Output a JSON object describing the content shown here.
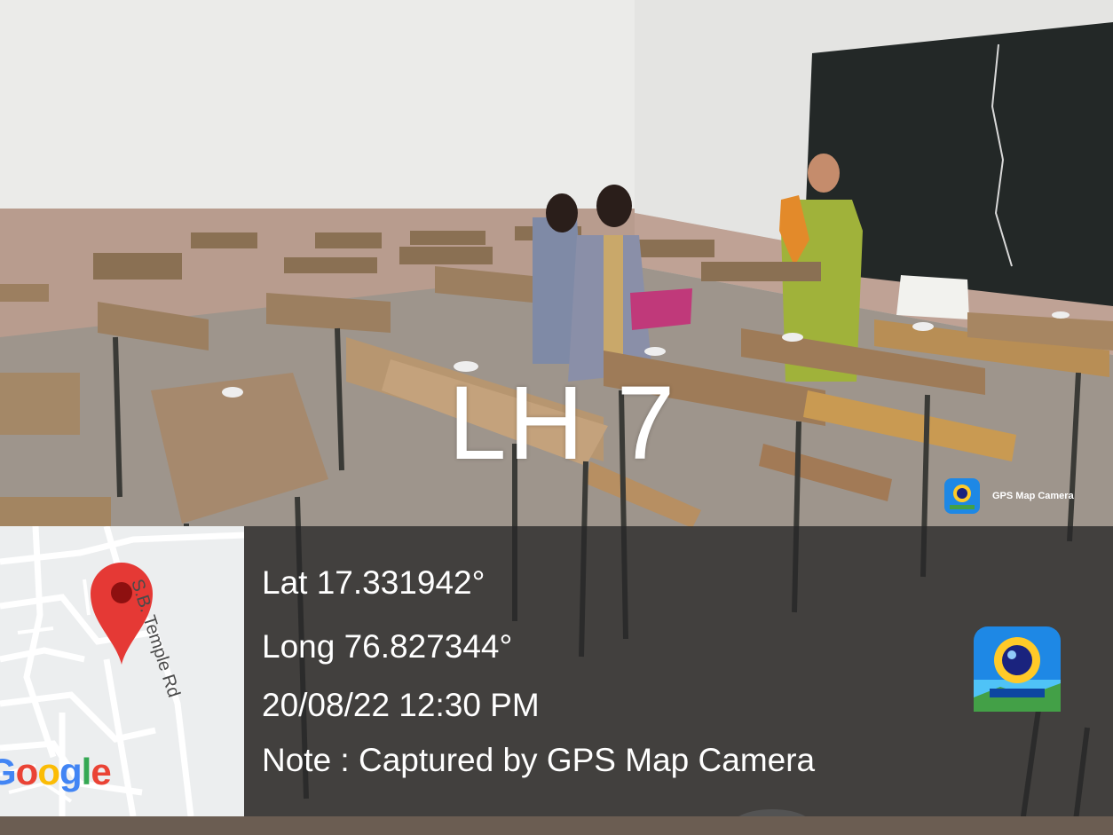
{
  "overlay": {
    "room_label": "LH 7",
    "app_badge_text": "GPS Map Camera",
    "latitude": "Lat 17.331942°",
    "longitude": "Long 76.827344°",
    "datetime": "20/08/22 12:30 PM",
    "note": "Note : Captured by GPS Map Camera"
  },
  "map": {
    "road_name": "S.B. Temple Rd",
    "logo_letters": [
      "G",
      "o",
      "o",
      "g",
      "l",
      "e"
    ],
    "logo_colors": [
      "#4285F4",
      "#EA4335",
      "#FBBC05",
      "#4285F4",
      "#34A853",
      "#EA4335"
    ],
    "pin_color": "#E53935"
  },
  "icons": {
    "pin": "map-pin-icon",
    "app": "gps-camera-app-icon"
  },
  "colors": {
    "panel": "#2b2b2b",
    "text": "#ffffff",
    "app_icon_bg": "#1e88e5"
  }
}
